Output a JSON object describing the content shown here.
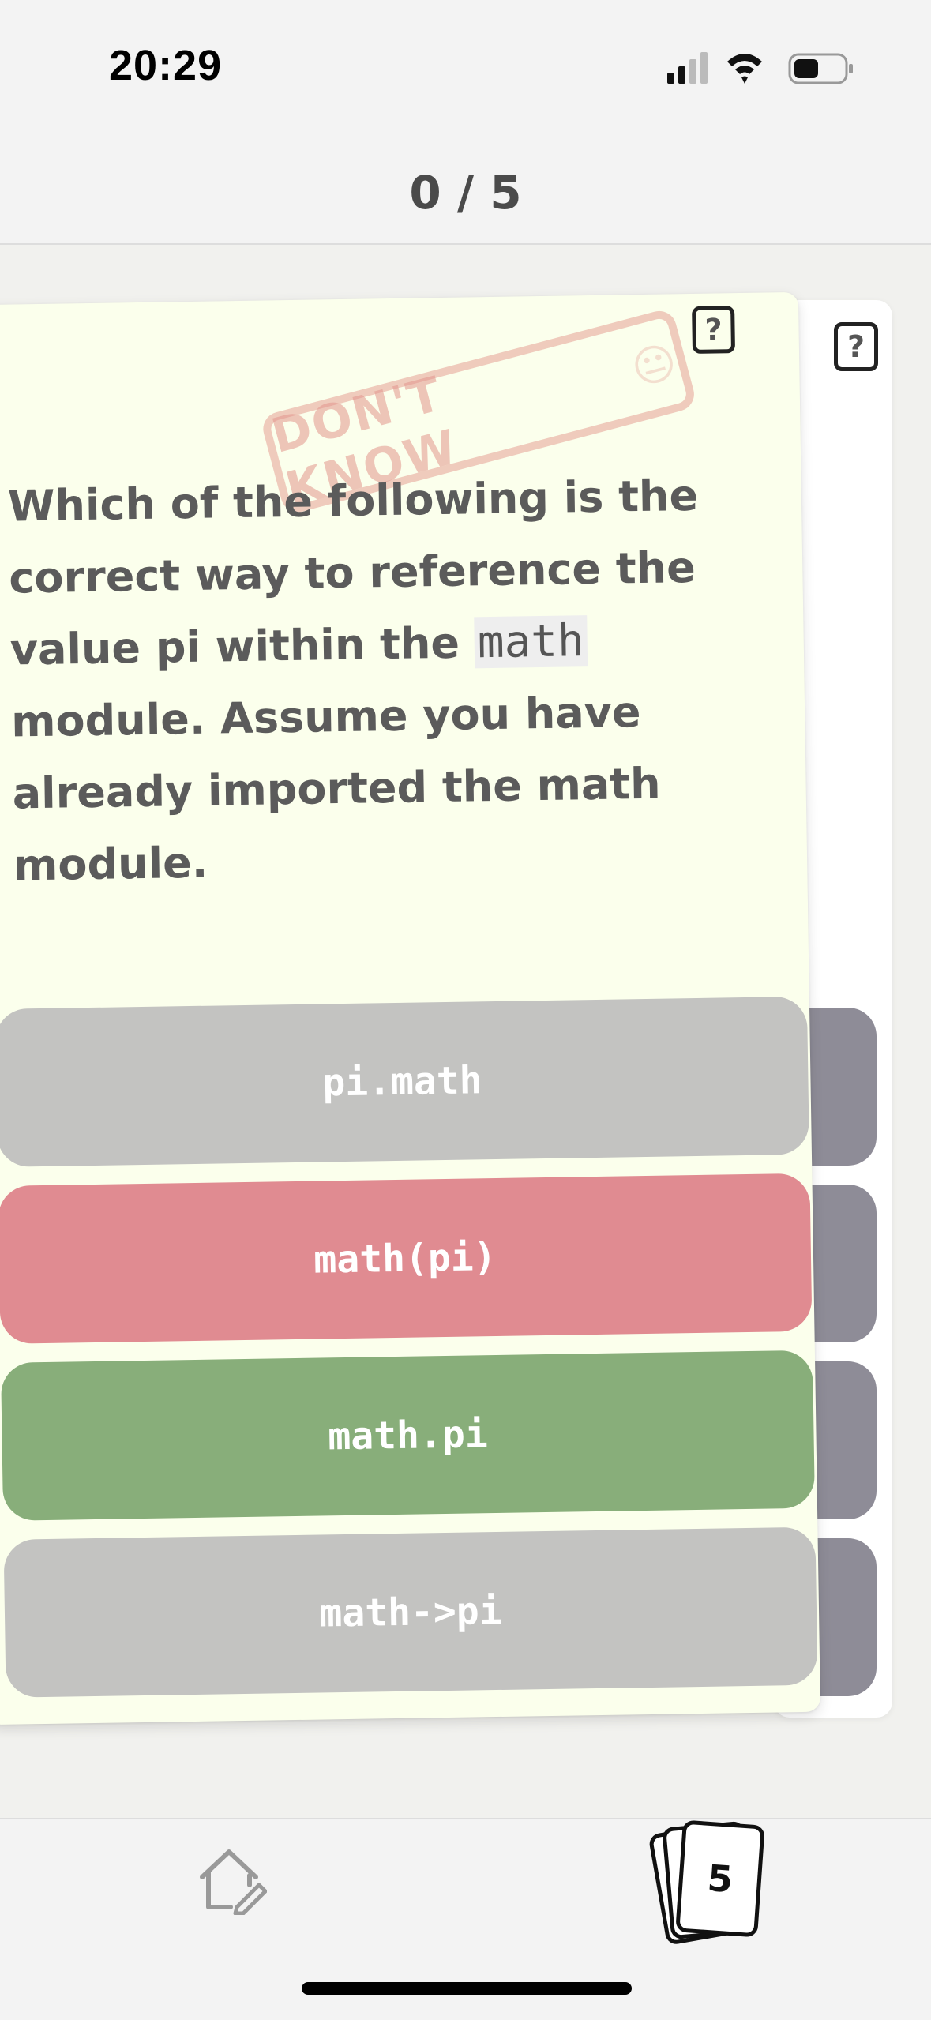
{
  "status_bar": {
    "time": "20:29"
  },
  "header": {
    "progress": "0 / 5"
  },
  "card": {
    "help_label": "?",
    "stamp": {
      "text": "DON'T KNOW",
      "emoji": "😐"
    },
    "question": {
      "before": "Which of the following is the correct way to reference the value pi within the",
      "code": "math",
      "after": "module. Assume you have already imported the math module."
    },
    "options": [
      {
        "label": "pi.math",
        "state": "neutral"
      },
      {
        "label": "math(pi)",
        "state": "incorrect"
      },
      {
        "label": "math.pi",
        "state": "correct"
      },
      {
        "label": "math->pi",
        "state": "neutral"
      }
    ]
  },
  "nav": {
    "home_icon": "home-edit-icon",
    "deck_icon": "card-deck-icon",
    "deck_count": "5"
  },
  "colors": {
    "card_background": "#fbffec",
    "option_neutral": "#c3c3c1",
    "option_incorrect": "#e08b91",
    "option_correct": "#88ae7a",
    "stamp": "#e6a096"
  }
}
